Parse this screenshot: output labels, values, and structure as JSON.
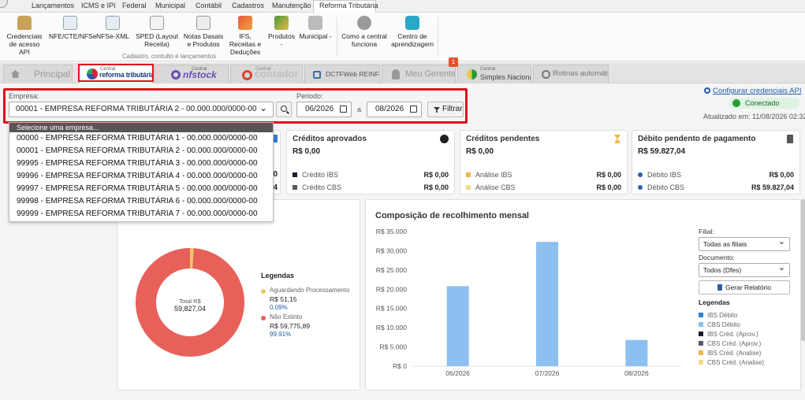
{
  "menu": [
    "Lançamentos",
    "ICMS e IPI",
    "Federal",
    "Municipal",
    "Contábil",
    "Cadastros",
    "Manutenção",
    "Reforma Tributária"
  ],
  "ribbon": {
    "buttons": [
      {
        "label": "Credenciais de acesso API",
        "icon": "lock-icon"
      },
      {
        "label": "NFE/CTE/NFSe",
        "icon": "search-doc-icon"
      },
      {
        "label": "NFSe-XML",
        "icon": "search-doc-icon"
      },
      {
        "label": "SPED (Layout Receita)",
        "icon": "sped-icon"
      },
      {
        "label": "Notas Dasais e Produtos",
        "icon": "documents-icon"
      },
      {
        "label": "IFS, Receitas e Deduções",
        "icon": "ifs-icon"
      },
      {
        "label": "Produtos -",
        "icon": "boxes-icon"
      },
      {
        "label": "Municipal -",
        "icon": "building-icon"
      },
      {
        "label": "Como a central funciona",
        "icon": "help-icon"
      },
      {
        "label": "Centro de aprendizagem",
        "icon": "learning-icon"
      }
    ],
    "group_label": "Cadastro, contulto e lançamentos"
  },
  "tabs": [
    {
      "label": "Principal",
      "icon": "home-icon"
    },
    {
      "label": "reforma tributária",
      "prefix": "Central"
    },
    {
      "label": "nfstock",
      "prefix": "Central"
    },
    {
      "label": "contador",
      "prefix": "Central"
    },
    {
      "label": "DCTFWeb REINF/MIT"
    },
    {
      "label": "Meu Gerente"
    },
    {
      "label": "Simples Nacional",
      "prefix": "Central"
    },
    {
      "label": "Rotinas automáticas"
    }
  ],
  "badge": "1",
  "filter": {
    "empresa_label": "Empresa:",
    "empresa_value": "00001 - EMPRESA REFORMA TRIBUTÁRIA 2 - 00.000.000/0000-00",
    "periodo_label": "Periodo:",
    "date_from": "06/2026",
    "date_sep": "a",
    "date_to": "08/2026",
    "filter_button": "Filtrar"
  },
  "dropdown": {
    "header": "Selecione uma empresa...",
    "options": [
      "00000 - EMPRESA REFORMA TRIBUTÁRIA 1 - 00.000.000/0000-00",
      "00001 - EMPRESA REFORMA TRIBUTÁRIA 2 - 00.000.000/0000-00",
      "99995 - EMPRESA REFORMA TRIBUTÁRIA 3 - 00.000.000/0000-00",
      "99996 - EMPRESA REFORMA TRIBUTÁRIA 4 - 00.000.000/0000-00",
      "99997 - EMPRESA REFORMA TRIBUTÁRIA 5 - 00.000.000/0000-00",
      "99998 - EMPRESA REFORMA TRIBUTÁRIA 6 - 00.000.000/0000-00",
      "99999 - EMPRESA REFORMA TRIBUTÁRIA 7 - 00.000.000/0000-00"
    ]
  },
  "status": {
    "config_link": "Configurar credenciais API",
    "connected": "Conectado",
    "updated": "Atualizado em: 11/08/2026 02:32"
  },
  "cards": [
    {
      "title": "Créditos aprovados",
      "value": "R$ 0,00",
      "rows": [
        {
          "label": "Crédito IBS",
          "value": "R$ 0,00",
          "color": "#1a1f2e"
        },
        {
          "label": "Crédito CBS",
          "value": "R$ 0,00",
          "color": "#555b66"
        }
      ]
    },
    {
      "title": "Créditos pendentes",
      "value": "R$ 0,00",
      "rows": [
        {
          "label": "Análise IBS",
          "value": "R$ 0,00",
          "color": "#e8b84a"
        },
        {
          "label": "Análise CBS",
          "value": "R$ 0,00",
          "color": "#f2dc8c"
        }
      ]
    },
    {
      "title": "Débito pendento de pagamento",
      "value": "R$ 59.827,04",
      "rows": [
        {
          "label": "Débito IBS",
          "value": "R$ 0,00",
          "color": "#2e5fa8"
        },
        {
          "label": "Débito CBS",
          "value": "R$ 59.827,04",
          "color": "#2e5fa8"
        }
      ]
    }
  ],
  "partial_card_values": [
    "0",
    "4"
  ],
  "donut": {
    "center_label": "Total R$",
    "center_value": "59,827,04",
    "legend_title": "Legendas",
    "items": [
      {
        "label": "Aguardando Processamento",
        "value": "R$ 51,15",
        "pct": "0.09%",
        "color": "#f0c66b",
        "fraction": 0.0009
      },
      {
        "label": "Não Estinto",
        "value": "R$ 59,775,89",
        "pct": "99.91%",
        "color": "#e8605a",
        "fraction": 0.9991
      }
    ]
  },
  "bar_chart": {
    "title": "Composição de recolhimento mensal",
    "filial_label": "Filial:",
    "filial_value": "Todas as filiais",
    "documento_label": "Documento:",
    "documento_value": "Todos (Dfes)",
    "report_button": "Gerar Relatório",
    "legend_title": "Legendas",
    "legend": [
      {
        "label": "IBS Débito",
        "color": "#2f7fd0"
      },
      {
        "label": "CBS Débito",
        "color": "#8cc0f0"
      },
      {
        "label": "IBS Créd. (Aprov.)",
        "color": "#1a1f2e"
      },
      {
        "label": "CBS Créd. (Aprov.)",
        "color": "#555b66"
      },
      {
        "label": "IBS Créd. (Analise)",
        "color": "#e8b84a"
      },
      {
        "label": "CBS Créd. (Analise)",
        "color": "#f2dc8c"
      }
    ]
  },
  "chart_data": {
    "type": "bar",
    "title": "Composição de recolhimento mensal",
    "categories": [
      "06/2026",
      "07/2026",
      "08/2026"
    ],
    "series": [
      {
        "name": "CBS Débito",
        "values": [
          20800,
          32300,
          6800
        ]
      }
    ],
    "ylim": [
      0,
      35000
    ],
    "yticks": [
      "R$ 0",
      "R$ 5.000",
      "R$ 10.000",
      "R$ 15.000",
      "R$ 20.000",
      "R$ 25.000",
      "R$ 30.000",
      "R$ 35.000"
    ],
    "yvalues": [
      0,
      5000,
      10000,
      15000,
      20000,
      25000,
      30000,
      35000
    ],
    "grid": false,
    "legend_position": "right"
  }
}
